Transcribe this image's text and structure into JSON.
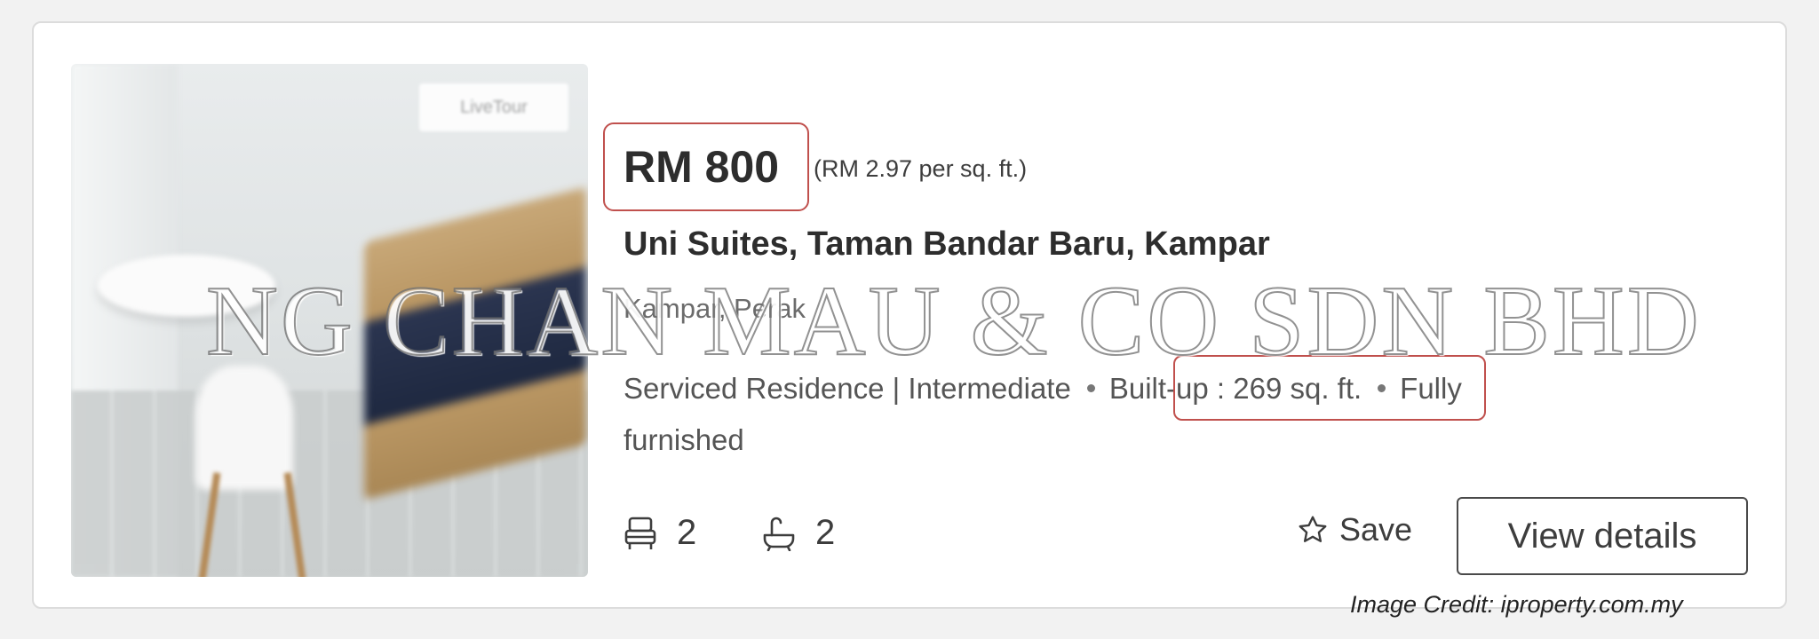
{
  "listing": {
    "photo_badge": "LiveTour",
    "price": "RM 800",
    "price_per_sqft": "(RM 2.97 per sq. ft.)",
    "title": "Uni Suites, Taman Bandar Baru, Kampar",
    "location": "Kampar, Perak",
    "property_type": "Serviced Residence | Intermediate",
    "built_up": "Built-up : 269 sq. ft.",
    "furnishing_part1": "Fully",
    "furnishing_part2": "furnished",
    "bedrooms": "2",
    "bathrooms": "2",
    "bed_icon": "bed-icon",
    "bath_icon": "bathtub-icon"
  },
  "actions": {
    "save_label": "Save",
    "view_details_label": "View details"
  },
  "overlay": {
    "watermark": "NG CHAN MAU & CO SDN BHD",
    "credit": "Image Credit: iproperty.com.my"
  },
  "colors": {
    "highlight": "#c0504d",
    "text_primary": "#2d2d2d",
    "text_secondary": "#555555"
  }
}
